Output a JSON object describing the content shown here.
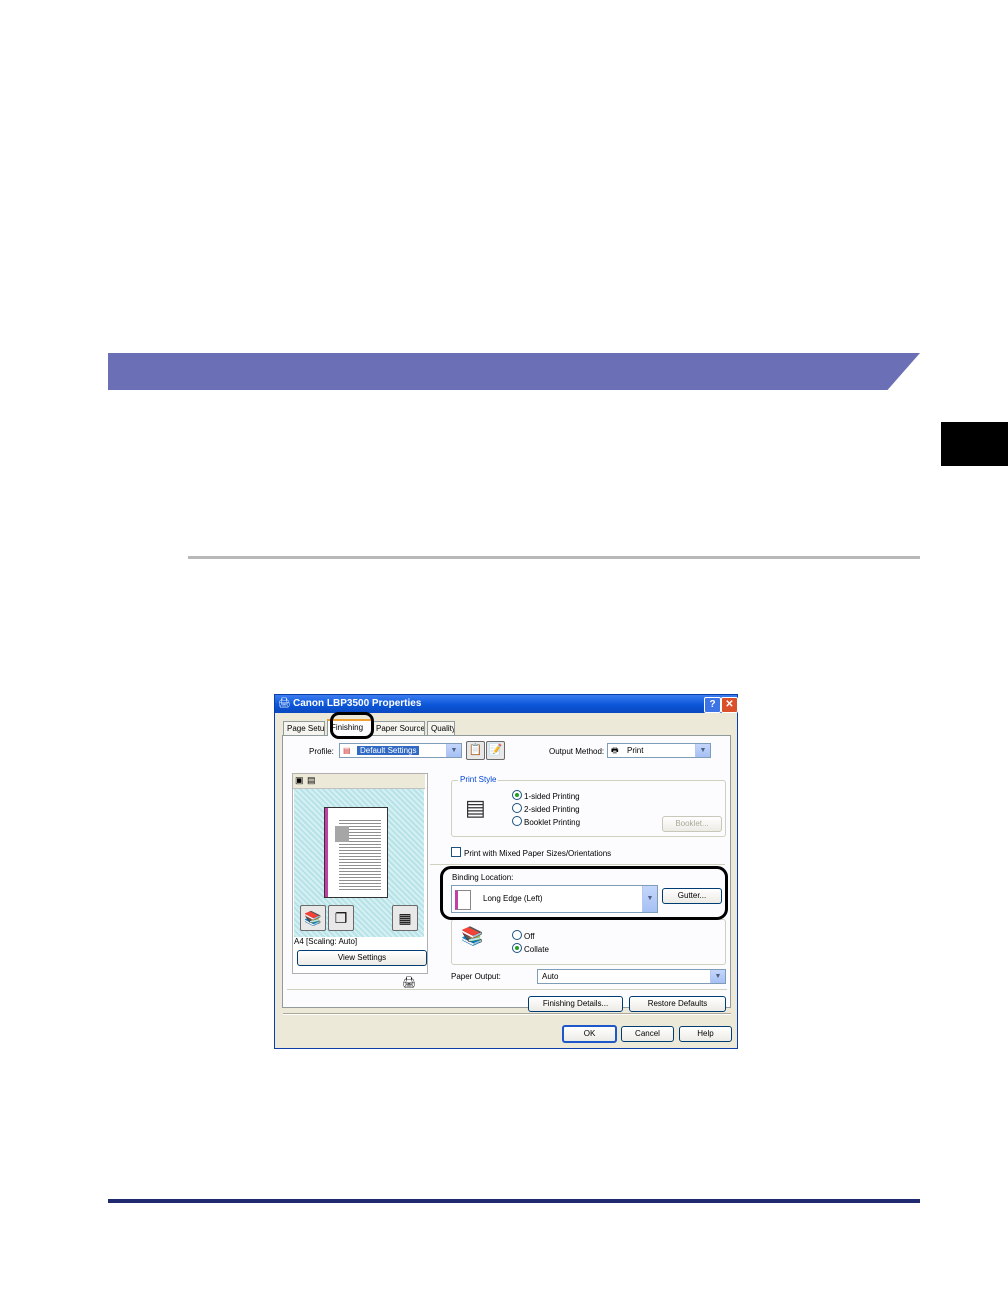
{
  "dialog": {
    "title": "Canon LBP3500 Properties",
    "title_icon": "printer-icon",
    "help_label": "?",
    "close_label": "✕",
    "tabs": [
      {
        "label": "Page Setup"
      },
      {
        "label": "Finishing"
      },
      {
        "label": "Paper Source"
      },
      {
        "label": "Quality"
      }
    ],
    "profile": {
      "label": "Profile:",
      "value": "Default Settings"
    },
    "output_method": {
      "label": "Output Method:",
      "value": "Print"
    },
    "preview": {
      "status": "A4 [Scaling: Auto]",
      "view_settings_label": "View Settings"
    },
    "print_style": {
      "legend": "Print Style",
      "options": [
        {
          "label": "1-sided Printing",
          "selected": true
        },
        {
          "label": "2-sided Printing",
          "selected": false
        },
        {
          "label": "Booklet Printing",
          "selected": false
        }
      ],
      "booklet_button": "Booklet..."
    },
    "mixed_sizes": {
      "label": "Print with Mixed Paper Sizes/Orientations",
      "checked": false
    },
    "binding": {
      "label": "Binding Location:",
      "value": "Long Edge (Left)",
      "gutter_button": "Gutter..."
    },
    "collate": {
      "options": [
        {
          "label": "Off",
          "selected": false
        },
        {
          "label": "Collate",
          "selected": true
        }
      ]
    },
    "paper_output": {
      "label": "Paper Output:",
      "value": "Auto"
    },
    "finishing_details_button": "Finishing Details...",
    "restore_defaults_button": "Restore Defaults",
    "ok_button": "OK",
    "cancel_button": "Cancel",
    "help_button": "Help"
  }
}
